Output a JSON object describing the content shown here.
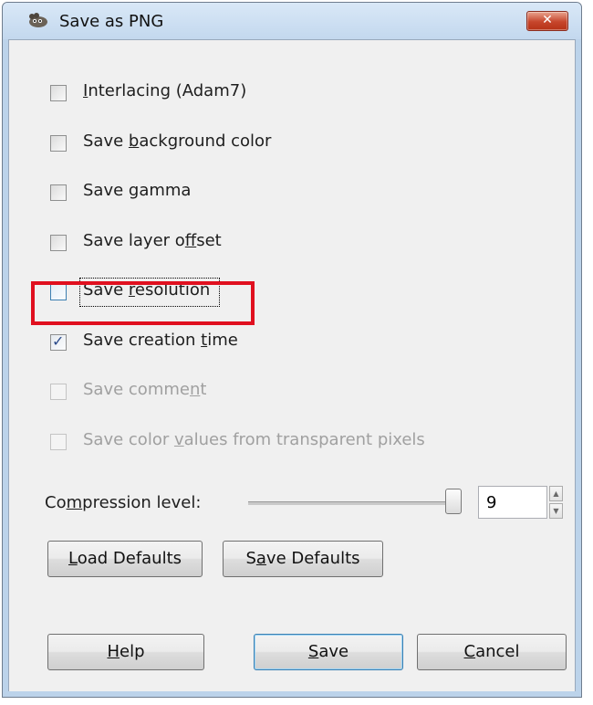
{
  "window": {
    "title": "Save as PNG",
    "close_glyph": "✕"
  },
  "options": [
    {
      "pre": "",
      "mn": "I",
      "post": "nterlacing (Adam7)",
      "checked": false,
      "enabled": true
    },
    {
      "pre": "Save ",
      "mn": "b",
      "post": "ackground color",
      "checked": false,
      "enabled": true
    },
    {
      "pre": "Save gamma",
      "mn": "",
      "post": "",
      "checked": false,
      "enabled": true
    },
    {
      "pre": "Save layer o",
      "mn": "f",
      "post": "fset",
      "checked": false,
      "enabled": true
    },
    {
      "pre": "Save ",
      "mn": "r",
      "post": "esolution",
      "checked": false,
      "enabled": true,
      "focused": true
    },
    {
      "pre": "Save creation ",
      "mn": "t",
      "post": "ime",
      "checked": true,
      "enabled": true
    },
    {
      "pre": "Save comme",
      "mn": "n",
      "post": "t",
      "checked": false,
      "enabled": false
    },
    {
      "pre": "Save color ",
      "mn": "v",
      "post": "alues from transparent pixels",
      "checked": false,
      "enabled": false
    }
  ],
  "compression": {
    "pre": "Co",
    "mn": "m",
    "post": "pression level:",
    "value": "9",
    "max": 9
  },
  "buttons": {
    "load_defaults": {
      "pre": "",
      "mn": "L",
      "post": "oad Defaults"
    },
    "save_defaults": {
      "pre": "S",
      "mn": "a",
      "post": "ve Defaults"
    },
    "help": {
      "pre": "",
      "mn": "H",
      "post": "elp"
    },
    "save": {
      "pre": "",
      "mn": "S",
      "post": "ave"
    },
    "cancel": {
      "pre": "",
      "mn": "C",
      "post": "ancel"
    }
  },
  "colors": {
    "highlight": "#e0101f",
    "check": "#2a4a8a"
  }
}
